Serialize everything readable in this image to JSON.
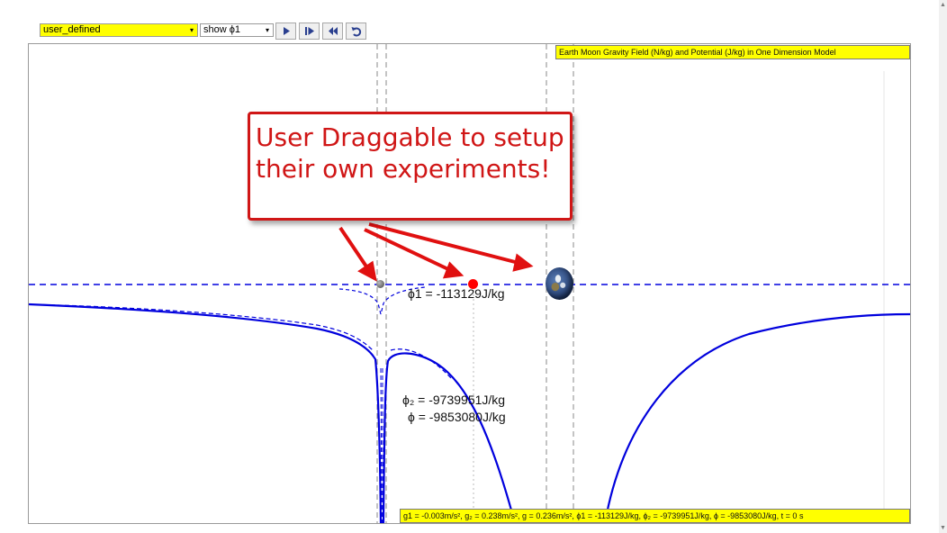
{
  "toolbar": {
    "scenario": "user_defined",
    "show": "show ϕ1",
    "caret": "▾",
    "buttons": [
      "play-icon",
      "step-forward-icon",
      "rewind-icon",
      "reset-icon"
    ]
  },
  "plot": {
    "title": "Earth Moon Gravity Field (N/kg) and Potential (J/kg) in One Dimension Model",
    "status": "g1 = -0.003m/s², g₂ = 0.238m/s², g = 0.236m/s², ϕ1 = -113129J/kg, ϕ₂ = -9739951J/kg, ϕ = -9853080J/kg, t = 0 s",
    "phi1_label": "ϕ1 = -113129J/kg",
    "phi2_label": "ϕ₂ = -9739951J/kg",
    "phi_label": "ϕ = -9853080J/kg",
    "colors": {
      "curve": "#0000dd",
      "highlight": "#ffff00",
      "callout": "#d01616"
    }
  },
  "callout": {
    "text": "User Draggable to setup their own experiments!"
  },
  "objects": {
    "moon": "moon",
    "test_mass": "test-mass",
    "earth": "earth"
  }
}
